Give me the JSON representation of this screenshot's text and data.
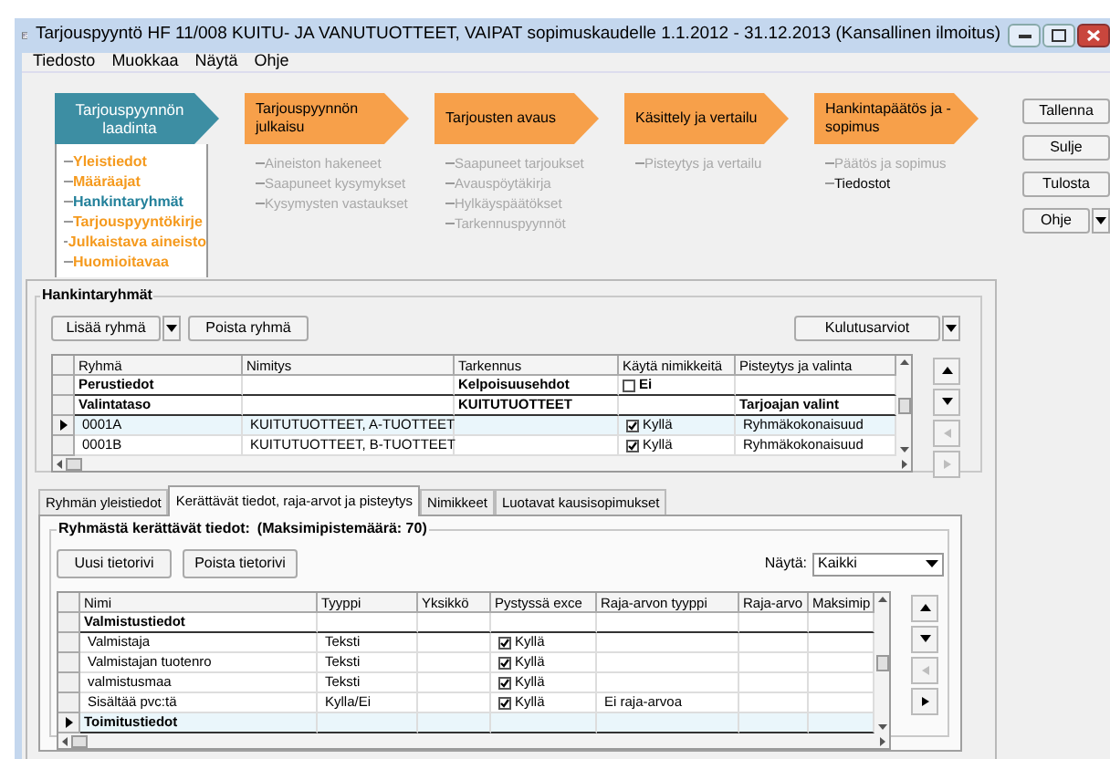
{
  "window": {
    "title": "Tarjouspyyntö HF 11/008 KUITU- JA VANUTUOTTEET, VAIPAT sopimuskaudelle 1.1.2012 - 31.12.2013 (Kansallinen ilmoitus)"
  },
  "menu": [
    "Tiedosto",
    "Muokkaa",
    "Näytä",
    "Ohje"
  ],
  "process_steps": [
    {
      "label": "Tarjouspyynnön laadinta",
      "selected": true,
      "items": [
        {
          "label": "Yleistiedot",
          "kind": "link"
        },
        {
          "label": "Määräajat",
          "kind": "link"
        },
        {
          "label": "Hankintaryhmät",
          "kind": "current"
        },
        {
          "label": "Tarjouspyyntökirje",
          "kind": "link"
        },
        {
          "label": "Julkaistava aineisto",
          "kind": "link"
        },
        {
          "label": "Huomioitavaa",
          "kind": "link"
        }
      ]
    },
    {
      "label": "Tarjouspyynnön julkaisu",
      "selected": false,
      "items": [
        {
          "label": "Aineiston hakeneet",
          "kind": "disabled"
        },
        {
          "label": "Saapuneet kysymykset",
          "kind": "disabled"
        },
        {
          "label": "Kysymysten vastaukset",
          "kind": "disabled"
        }
      ]
    },
    {
      "label": "Tarjousten avaus",
      "selected": false,
      "items": [
        {
          "label": "Saapuneet tarjoukset",
          "kind": "disabled"
        },
        {
          "label": "Avauspöytäkirja",
          "kind": "disabled"
        },
        {
          "label": "Hylkäyspäätökset",
          "kind": "disabled"
        },
        {
          "label": "Tarkennuspyynnöt",
          "kind": "disabled"
        }
      ]
    },
    {
      "label": "Käsittely ja vertailu",
      "selected": false,
      "items": [
        {
          "label": "Pisteytys ja vertailu",
          "kind": "disabled"
        }
      ]
    },
    {
      "label": "Hankintapäätös ja -sopimus",
      "selected": false,
      "items": [
        {
          "label": "Päätös ja sopimus",
          "kind": "disabled"
        },
        {
          "label": "Tiedostot",
          "kind": "plain"
        }
      ]
    }
  ],
  "actions": [
    {
      "label": "Tallenna",
      "dropdown": false
    },
    {
      "label": "Sulje",
      "dropdown": false
    },
    {
      "label": "Tulosta",
      "dropdown": false
    },
    {
      "label": "Ohje",
      "dropdown": true
    }
  ],
  "group": {
    "title": "Hankintaryhmät",
    "buttons": [
      {
        "label": "Lisää ryhmä",
        "dropdown": true
      },
      {
        "label": "Poista ryhmä",
        "dropdown": false
      }
    ],
    "extra_button": {
      "label": "Kulutusarviot",
      "dropdown": true
    },
    "table": {
      "columns": [
        "Ryhmä",
        "Nimitys",
        "Tarkennus",
        "Käytä nimikkeitä",
        "Pisteytys ja valinta"
      ],
      "rows": [
        {
          "kind": "heading",
          "selected": false,
          "ryhma": "Perustiedot",
          "tarkennus": "Kelpoisuusehdot",
          "kayta": {
            "checked": false,
            "text": "Ei"
          }
        },
        {
          "kind": "heading",
          "selected": false,
          "ryhma": "Valintataso",
          "tarkennus": "KUITUTUOTTEET",
          "pisteytys": "Tarjoajan valint"
        },
        {
          "kind": "item",
          "selected": true,
          "ryhma": "0001A",
          "nimitys": "KUITUTUOTTEET, A-TUOTTEET",
          "kayta": {
            "checked": true,
            "text": "Kyllä"
          },
          "pisteytys": "Ryhmäkokonaisuud"
        },
        {
          "kind": "item",
          "selected": false,
          "ryhma": "0001B",
          "nimitys": "KUITUTUOTTEET, B-TUOTTEET",
          "kayta": {
            "checked": true,
            "text": "Kyllä"
          },
          "pisteytys": "Ryhmäkokonaisuud"
        }
      ]
    },
    "nav": [
      {
        "kind": "up",
        "disabled": false
      },
      {
        "kind": "down",
        "disabled": false
      },
      {
        "kind": "left",
        "disabled": true
      },
      {
        "kind": "right",
        "disabled": true
      }
    ]
  },
  "tabs": [
    {
      "label": "Ryhmän yleistiedot",
      "selected": false
    },
    {
      "label": "Kerättävät tiedot, raja-arvot ja pisteytys",
      "selected": true
    },
    {
      "label": "Nimikkeet",
      "selected": false
    },
    {
      "label": "Luotavat kausisopimukset",
      "selected": false
    }
  ],
  "tab_panel": {
    "title": "Ryhmästä kerättävät tiedot:",
    "max_points": "(Maksimipistemäärä: 70)",
    "buttons": [
      "Uusi tietorivi",
      "Poista tietorivi"
    ],
    "filter": {
      "label": "Näytä:",
      "value": "Kaikki"
    },
    "table": {
      "columns": [
        "Nimi",
        "Tyyppi",
        "Yksikkö",
        "Pystyssä exce",
        "Raja-arvon tyyppi",
        "Raja-arvo",
        "Maksimip"
      ],
      "rows": [
        {
          "kind": "heading",
          "selected": false,
          "nimi": "Valmistustiedot"
        },
        {
          "kind": "item",
          "selected": false,
          "nimi": "Valmistaja",
          "tyyppi": "Teksti",
          "pystyssa": {
            "checked": true,
            "text": "Kyllä"
          }
        },
        {
          "kind": "item",
          "selected": false,
          "nimi": "Valmistajan tuotenro",
          "tyyppi": "Teksti",
          "pystyssa": {
            "checked": true,
            "text": "Kyllä"
          }
        },
        {
          "kind": "item",
          "selected": false,
          "nimi": "valmistusmaa",
          "tyyppi": "Teksti",
          "pystyssa": {
            "checked": true,
            "text": "Kyllä"
          }
        },
        {
          "kind": "item",
          "selected": false,
          "nimi": "Sisältää pvc:tä",
          "tyyppi": "Kylla/Ei",
          "pystyssa": {
            "checked": true,
            "text": "Kyllä"
          },
          "raja_tyyppi": "Ei raja-arvoa"
        },
        {
          "kind": "heading",
          "selected": true,
          "nimi": "Toimitustiedot"
        }
      ]
    },
    "nav": [
      {
        "kind": "up",
        "disabled": false
      },
      {
        "kind": "down",
        "disabled": false
      },
      {
        "kind": "left",
        "disabled": true
      },
      {
        "kind": "right",
        "disabled": false
      }
    ]
  }
}
